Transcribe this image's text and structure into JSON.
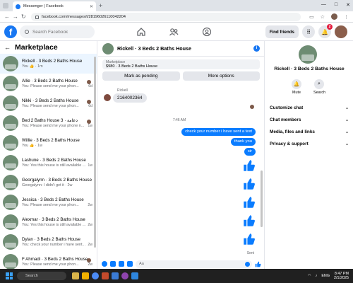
{
  "browser": {
    "tab_title": "Messenger | Facebook",
    "url": "facebook.com/messages/t/28196026110042204"
  },
  "fb": {
    "search_placeholder": "Search Facebook",
    "find_friends": "Find friends",
    "notif_count": "2"
  },
  "left": {
    "title": "Marketplace",
    "conversations": [
      {
        "name": "Rickell · 3 Beds 2 Baths House",
        "preview": "You 👍 · 1m",
        "meta": ""
      },
      {
        "name": "Allie · 3 Beds 2 Baths House",
        "preview": "You: Please send me your phon...",
        "meta": "6d"
      },
      {
        "name": "Nikki · 3 Beds 2 Baths House",
        "preview": "You: Please send me your phon...",
        "meta": "6d"
      },
      {
        "name": "Bed 2 Baths House 3 · دعامة",
        "preview": "You: Please send me your phone n...",
        "meta": "1w"
      },
      {
        "name": "Willie · 3 Beds 2 Baths House",
        "preview": "You 👍 · 1w",
        "meta": ""
      },
      {
        "name": "Lashune · 3 Beds 2 Baths House",
        "preview": "You: Yes this house is still available ...",
        "meta": "1w"
      },
      {
        "name": "Georgalynn · 3 Beds 2 Baths House",
        "preview": "Georgalynn: I didn't get it · 2w",
        "meta": ""
      },
      {
        "name": "Jessica · 3 Beds 2 Baths House",
        "preview": "You: Please send me your phon...",
        "meta": "2w"
      },
      {
        "name": "Alexmar · 3 Beds 2 Baths House",
        "preview": "You: Yes this house is still available ...",
        "meta": "2w"
      },
      {
        "name": "Dylan · 3 Beds 2 Baths House",
        "preview": "You: check your number i have sent... ",
        "meta": "2w"
      },
      {
        "name": "F Ahmadi · 3 Beds 2 Baths House",
        "preview": "You: Please send me your phon...",
        "meta": "2w"
      }
    ]
  },
  "chat": {
    "title": "Rickell · 3 Beds 2 Baths House",
    "marketplace_label": "Marketplace",
    "listing": "$980 · 3 Beds 2 Baths House",
    "mark_pending": "Mark as pending",
    "more_options": "More options",
    "sender_name": "Rickell",
    "incoming": "2164002364",
    "timestamp": "7:46 AM",
    "outgoing": [
      "check your number i have sent a text",
      "thank you",
      "sir"
    ],
    "sent_label": "Sent",
    "composer_placeholder": "Aa"
  },
  "right": {
    "name": "Rickell · 3 Beds 2 Baths House",
    "mute": "Mute",
    "search": "Search",
    "items": [
      "Customize chat",
      "Chat members",
      "Media, files and links",
      "Privacy & support"
    ]
  },
  "taskbar": {
    "search": "Search",
    "lang": "ENG",
    "time": "8:47 PM",
    "date": "2/1/2025"
  },
  "colors": {
    "fb_blue": "#1877f2",
    "messenger_blue": "#0a7cff",
    "active_row": "#ebf5ff"
  }
}
